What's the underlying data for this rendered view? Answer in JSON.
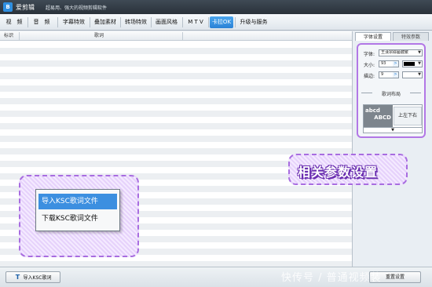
{
  "window": {
    "app_name": "爱剪辑",
    "slogan": "超易用、强大的视频剪辑软件",
    "logo_text": "B"
  },
  "menu": {
    "items": [
      {
        "label": "视　频",
        "active": false
      },
      {
        "label": "音　频",
        "active": false
      },
      {
        "label": "字幕特效",
        "active": false
      },
      {
        "label": "叠加素材",
        "active": false
      },
      {
        "label": "转场特效",
        "active": false
      },
      {
        "label": "画面风格",
        "active": false
      },
      {
        "label": "M T V",
        "active": false
      },
      {
        "label": "卡拉OK",
        "active": true
      },
      {
        "label": "升级与服务",
        "active": false
      }
    ]
  },
  "list": {
    "columns": [
      "标识",
      "歌词"
    ]
  },
  "right_panel": {
    "tabs": [
      {
        "label": "字体设置",
        "active": true
      },
      {
        "label": "特效参数",
        "active": false
      }
    ],
    "font": {
      "label": "字体:",
      "value": "王漢宗綜藝體繁"
    },
    "size": {
      "label": "大小:",
      "value": "93",
      "color": "#000000"
    },
    "stroke": {
      "label": "描边:",
      "value": "9"
    },
    "layout_title": "歌词布局",
    "preview": {
      "line1": "abcd",
      "line2": "ABCD",
      "mode": "上左下右",
      "more": "▼"
    }
  },
  "context_menu": {
    "items": [
      {
        "label": "导入KSC歌词文件",
        "selected": true
      },
      {
        "label": "下载KSC歌词文件",
        "selected": false
      }
    ]
  },
  "callout": {
    "params_text": "相关参数设置"
  },
  "bottom": {
    "import_button": "导入KSC歌词",
    "import_icon": "T",
    "reset_button": "重置设置"
  },
  "watermark": "快传号 / 普通视频装",
  "colors": {
    "accent": "#2a82d6",
    "callout_border": "#a86de0"
  }
}
